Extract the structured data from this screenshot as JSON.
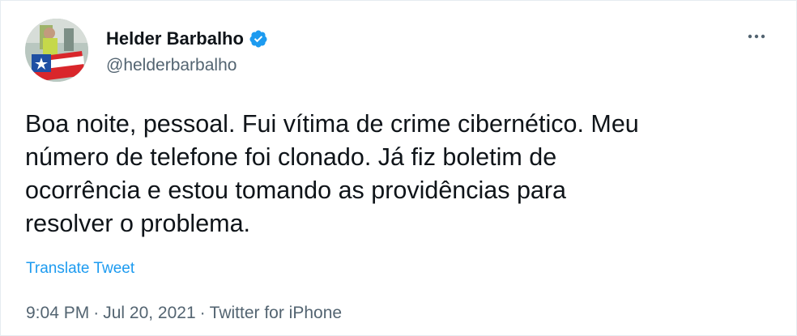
{
  "author": {
    "display_name": "Helder Barbalho",
    "handle": "@helderbarbalho",
    "verified_icon": "verified-badge-icon"
  },
  "tweet": {
    "text": "Boa noite, pessoal. Fui vítima de crime cibernético. Meu\nnúmero de telefone foi clonado. Já fiz boletim de\nocorrência e estou tomando as providências para\nresolver o problema.",
    "translate_label": "Translate Tweet"
  },
  "meta": {
    "time": "9:04 PM",
    "separator": "·",
    "date": "Jul 20, 2021",
    "source": "Twitter for iPhone"
  },
  "icons": {
    "more": "more-options-icon"
  },
  "colors": {
    "accent": "#1d9bf0",
    "text_primary": "#0f1419",
    "text_secondary": "#536471"
  }
}
